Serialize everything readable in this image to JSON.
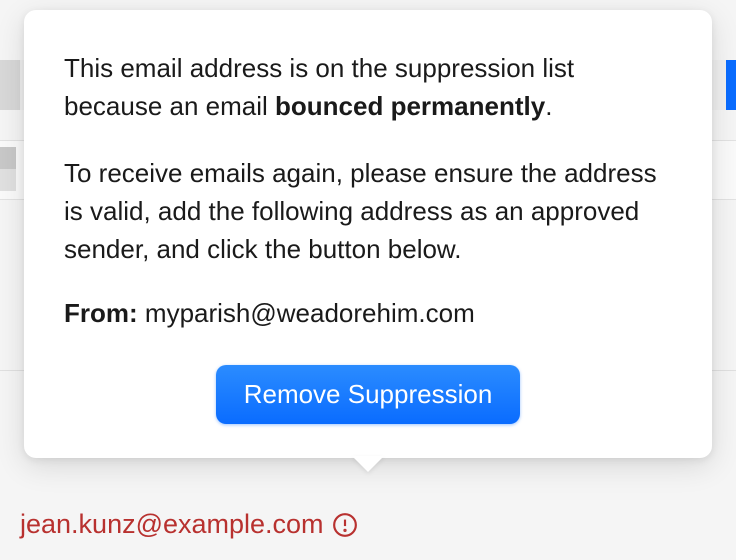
{
  "popover": {
    "line1_prefix": "This email address is on the suppression list because an email ",
    "line1_bold": "bounced permanently",
    "line1_suffix": ".",
    "line2": "To receive emails again, please ensure the address is valid, add the following address as an approved sender, and click the button below.",
    "from_label": "From:",
    "from_value": "myparish@weadorehim.com",
    "button_label": "Remove Suppression"
  },
  "suppressed_email": "jean.kunz@example.com",
  "colors": {
    "primary": "#0a6cff",
    "error": "#b8312f"
  }
}
